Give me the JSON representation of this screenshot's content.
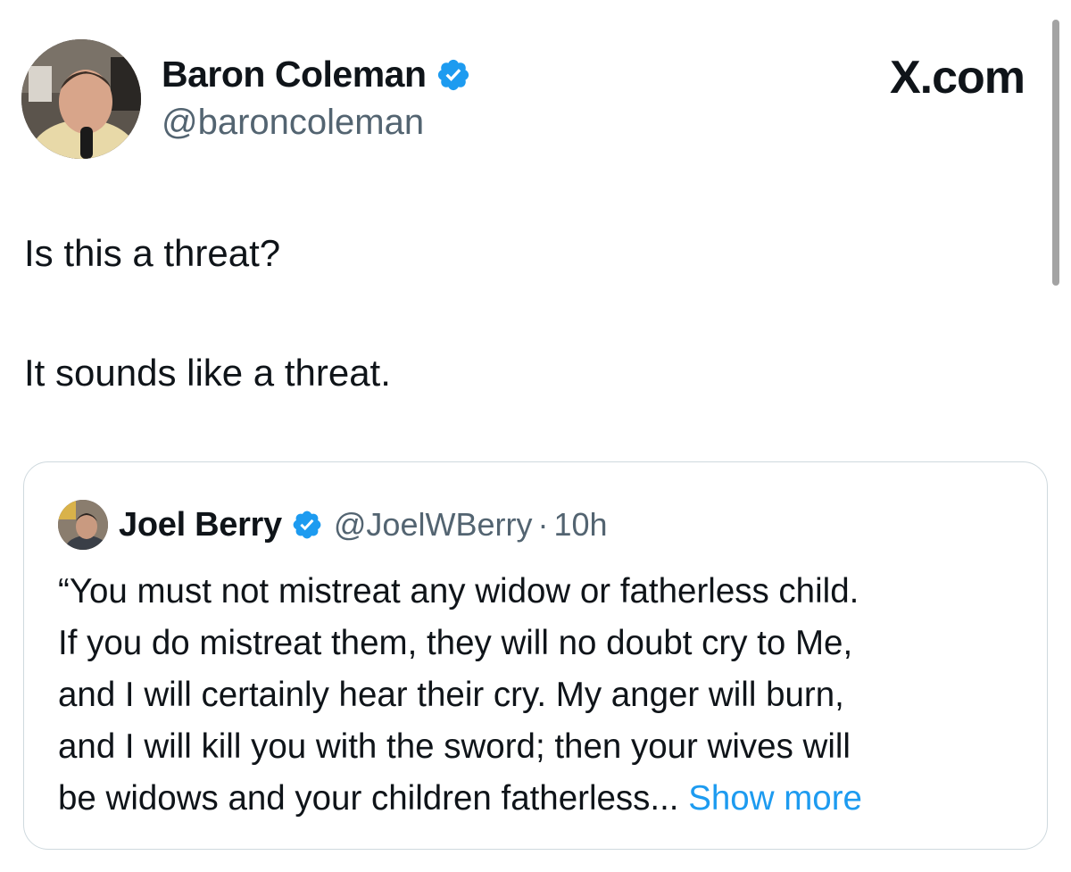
{
  "author": {
    "name": "Baron Coleman",
    "handle": "@baroncoleman"
  },
  "brand": "X.com",
  "tweet": {
    "lines": [
      "Is this a threat?",
      "It sounds like a threat."
    ]
  },
  "quote": {
    "name": "Joel Berry",
    "handle": "@JoelWBerry",
    "separator": "·",
    "time": "10h",
    "lines": [
      "“You must not mistreat any widow or fatherless child.",
      "If you do mistreat them, they will no doubt cry to Me,",
      "and I will certainly hear their cry. My anger will burn,",
      "and I will kill you with the sword; then your wives will",
      "be widows and your children fatherless..."
    ],
    "show_more": "Show more"
  },
  "colors": {
    "verified": "#1d9bf0",
    "link": "#1d9bf0",
    "muted": "#536471",
    "text": "#0f1419",
    "border": "#cfd9de"
  }
}
